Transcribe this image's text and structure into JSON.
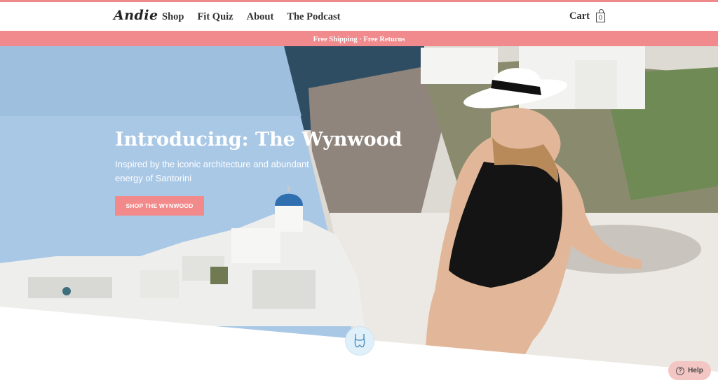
{
  "brand": {
    "logo": "Andie",
    "accent": "#f08a8c"
  },
  "nav": {
    "items": [
      "Shop",
      "Fit Quiz",
      "About",
      "The Podcast"
    ],
    "cart_label": "Cart",
    "cart_count": "0"
  },
  "promo": {
    "text": "Free Shipping · Free Returns"
  },
  "hero": {
    "title": "Introducing: The Wynwood",
    "subtitle": "Inspired by the iconic architecture and abundant energy of Santorini",
    "cta_label": "SHOP THE WYNWOOD"
  },
  "help": {
    "label": "Help",
    "icon": "question-icon"
  },
  "icons": {
    "cart": "shopping-bag-icon",
    "scroll": "swimsuit-icon"
  }
}
